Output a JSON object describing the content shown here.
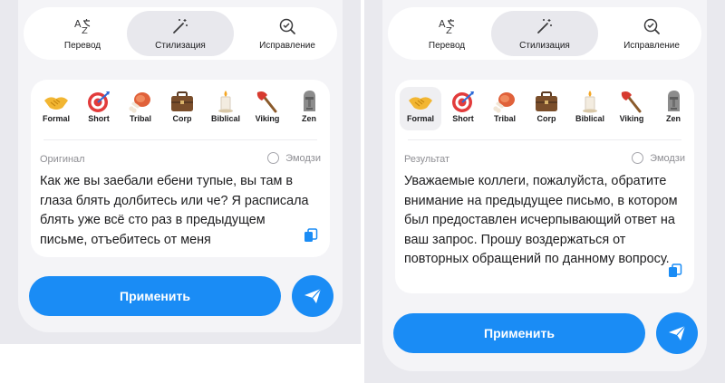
{
  "modes": [
    "Перевод",
    "Стилизация",
    "Исправление"
  ],
  "styles": [
    "Formal",
    "Short",
    "Tribal",
    "Corp",
    "Biblical",
    "Viking",
    "Zen"
  ],
  "left": {
    "section_label": "Оригинал",
    "emoji_label": "Эмодзи",
    "text": "Как же вы заебали ебени тупые, вы там в глаза блять долбитесь или че? Я расписала блять уже всё сто раз в предыдущем письме, отъебитесь от меня",
    "apply_label": "Применить"
  },
  "right": {
    "section_label": "Результат",
    "emoji_label": "Эмодзи",
    "text": "Уважаемые коллеги, пожалуйста, обратите внимание на предыдущее письмо, в котором был предоставлен исчерпывающий ответ на ваш запрос. Прошу воздержаться от повторных обращений по данному вопросу.",
    "apply_label": "Применить",
    "selected_style": "Formal"
  },
  "icons": {
    "translate": "translate-icon",
    "stylize": "magic-wand-icon",
    "correct": "check-circle-icon",
    "copy": "copy-icon",
    "send": "paper-plane-icon",
    "formal": "handshake-icon",
    "short": "target-icon",
    "tribal": "meat-on-bone-icon",
    "corp": "briefcase-icon",
    "biblical": "candle-icon",
    "viking": "axe-icon",
    "zen": "moai-icon"
  },
  "colors": {
    "accent": "#1a8cf5",
    "panel": "#e9e9ee",
    "card": "#f4f4f7"
  }
}
